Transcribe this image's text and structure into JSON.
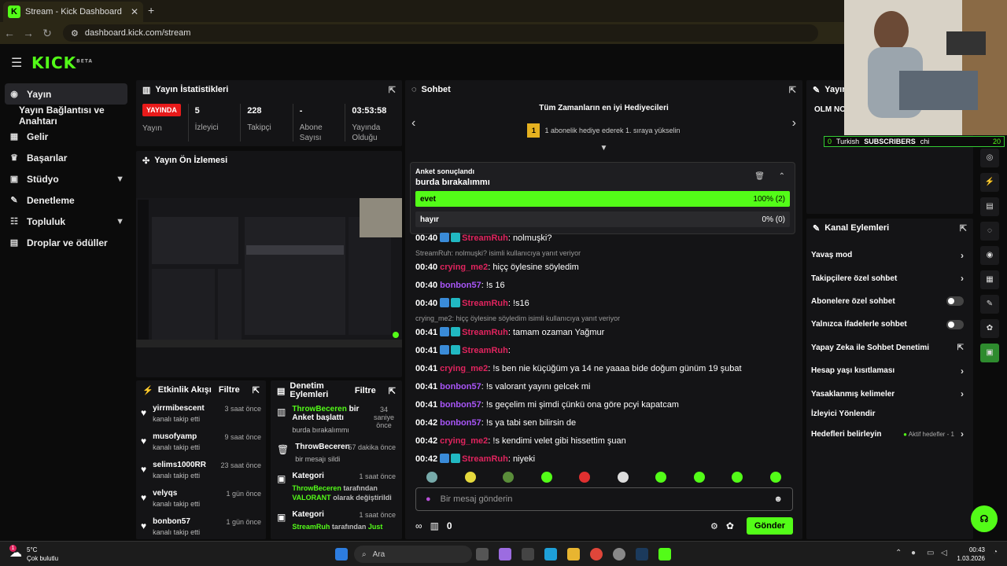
{
  "browser": {
    "tab_title": "Stream - Kick Dashboard",
    "url": "dashboard.kick.com/stream",
    "tab_badge": "5"
  },
  "app": {
    "logo": "KICK",
    "logo_sup": "BETA"
  },
  "sidebar": {
    "items": [
      {
        "label": "Yayın",
        "icon": "broadcast-icon"
      },
      {
        "label": "Yayın Bağlantısı ve Anahtarı"
      },
      {
        "label": "Gelir",
        "icon": "revenue-icon"
      },
      {
        "label": "Başarılar",
        "icon": "trophy-icon"
      },
      {
        "label": "Stüdyo",
        "icon": "studio-icon"
      },
      {
        "label": "Denetleme",
        "icon": "wrench-icon"
      },
      {
        "label": "Topluluk",
        "icon": "community-icon"
      },
      {
        "label": "Droplar ve ödüller",
        "icon": "drops-icon"
      }
    ]
  },
  "stats": {
    "title": "Yayın İstatistikleri",
    "live": "YAYINDA",
    "status_label": "Yayın",
    "viewers": "5",
    "viewers_label": "İzleyici",
    "followers": "228",
    "followers_label": "Takipçi",
    "subs": "-",
    "subs_label": "Abone Sayısı",
    "uptime": "03:53:58",
    "uptime_label": "Yayında Olduğu"
  },
  "preview": {
    "title": "Yayın Ön İzlemesi"
  },
  "activity": {
    "title": "Etkinlik Akışı",
    "filter": "Filtre",
    "items": [
      {
        "name": "yirrmibescent",
        "desc": "kanalı takip etti",
        "time": "3 saat önce"
      },
      {
        "name": "musofyamp",
        "desc": "kanalı takip etti",
        "time": "9 saat önce"
      },
      {
        "name": "selims1000RR",
        "desc": "kanalı takip etti",
        "time": "23 saat önce"
      },
      {
        "name": "velyqs",
        "desc": "kanalı takip etti",
        "time": "1 gün önce"
      },
      {
        "name": "bonbon57",
        "desc": "kanalı takip etti",
        "time": "1 gün önce"
      }
    ]
  },
  "modacts": {
    "title": "Denetim Eylemleri",
    "filter": "Filtre",
    "items": [
      {
        "name": "ThrowBeceren",
        "action": "bir Anket başlattı",
        "detail": "burda bırakalımmı",
        "time": "34 saniye önce"
      },
      {
        "name": "ThrowBeceren",
        "action": "",
        "detail": "bir mesajı sildi",
        "time": "57 dakika önce"
      },
      {
        "name": "Kategori",
        "action": "",
        "detail_a": "ThrowBeceren",
        "detail_b": "tarafından",
        "detail_c": "VALORANT",
        "detail_d": "olarak değiştirildi",
        "time": "1 saat önce"
      },
      {
        "name": "Kategori",
        "action": "",
        "detail_a": "StreamRuh",
        "detail_b": "tarafından",
        "detail_c": "Just",
        "time": "1 saat önce"
      }
    ]
  },
  "chat": {
    "title": "Sohbet",
    "gifters_title": "Tüm Zamanların en iyi Hediyecileri",
    "gifters_rank": "1",
    "gifters_text": "1 abonelik hediye ederek 1. sıraya yükselin",
    "poll": {
      "status": "Anket sonuçlandı",
      "question": "burda bırakalımmı",
      "options": [
        {
          "label": "evet",
          "result": "100% (2)",
          "fraction": 1.0
        },
        {
          "label": "hayır",
          "result": "0% (0)",
          "fraction": 0.0
        }
      ]
    },
    "messages": [
      {
        "time": "00:40",
        "user": "StreamRuh",
        "color": "#e0245e",
        "badges": 2,
        "text": ": nolmuşki?"
      },
      {
        "reply": "StreamRuh: nolmuşki? isimli kullanıcıya yanıt veriyor"
      },
      {
        "time": "00:40",
        "user": "crying_me2",
        "color": "#e0245e",
        "badges": 0,
        "text": ": hiçç öylesine söyledim"
      },
      {
        "time": "00:40",
        "user": "bonbon57",
        "color": "#a855f7",
        "badges": 0,
        "text": ": !s 16"
      },
      {
        "time": "00:40",
        "user": "StreamRuh",
        "color": "#e0245e",
        "badges": 2,
        "text": ": !s16"
      },
      {
        "reply": "crying_me2: hiçç öylesine söyledim isimli kullanıcıya yanıt veriyor"
      },
      {
        "time": "00:41",
        "user": "StreamRuh",
        "color": "#e0245e",
        "badges": 2,
        "text": ": tamam ozaman Yağmur"
      },
      {
        "time": "00:41",
        "user": "StreamRuh",
        "color": "#e0245e",
        "badges": 2,
        "text": ": "
      },
      {
        "time": "00:41",
        "user": "crying_me2",
        "color": "#e0245e",
        "badges": 0,
        "text": ": !s ben nie küçüğüm ya 14 ne yaaaa bide doğum günüm 19 şubat"
      },
      {
        "time": "00:41",
        "user": "bonbon57",
        "color": "#a855f7",
        "badges": 0,
        "text": ": !s valorant yayını gelcek mi"
      },
      {
        "time": "00:41",
        "user": "bonbon57",
        "color": "#a855f7",
        "badges": 0,
        "text": ": !s geçelim mi şimdi çünkü ona göre pcyi kapatcam"
      },
      {
        "time": "00:42",
        "user": "bonbon57",
        "color": "#a855f7",
        "badges": 0,
        "text": ": !s ya tabi sen bilirsin de"
      },
      {
        "time": "00:42",
        "user": "crying_me2",
        "color": "#e0245e",
        "badges": 0,
        "text": ": !s kendimi velet gibi hissettim şuan"
      },
      {
        "time": "00:42",
        "user": "StreamRuh",
        "color": "#e0245e",
        "badges": 2,
        "text": ": niyeki"
      }
    ],
    "input_placeholder": "Bir mesaj gönderin",
    "points": "0",
    "send": "Gönder"
  },
  "stream_panel": {
    "title": "Yayın B",
    "channel": "OLM NO"
  },
  "channel": {
    "title": "Kanal Eylemleri",
    "items": [
      {
        "label": "Yavaş mod",
        "type": "chevron"
      },
      {
        "label": "Takipçilere özel sohbet",
        "type": "chevron"
      },
      {
        "label": "Abonelere özel sohbet",
        "type": "toggle"
      },
      {
        "label": "Yalnızca ifadelerle sohbet",
        "type": "toggle"
      },
      {
        "label": "Yapay Zeka ile Sohbet Denetimi",
        "type": "external"
      },
      {
        "label": "Hesap yaşı kısıtlaması",
        "type": "chevron"
      },
      {
        "label": "Yasaklanmış kelimeler",
        "type": "chevron"
      },
      {
        "label": "İzleyici Yönlendir",
        "type": "none"
      },
      {
        "label": "Hedefleri belirleyin",
        "type": "chevron",
        "extra": "Aktif hedefler - 1"
      }
    ]
  },
  "overlay": {
    "count": "0",
    "lang": "Turkish",
    "subs": "SUBSCRIBERS",
    "chi": "chi",
    "num": "20"
  },
  "taskbar": {
    "temp": "5°C",
    "weather": "Çok bulutlu",
    "search": "Ara",
    "time": "00:43",
    "date": "1.03.2026",
    "weather_badge": "1"
  },
  "colors": {
    "accent": "#53fc18",
    "live": "#e81a1a"
  }
}
